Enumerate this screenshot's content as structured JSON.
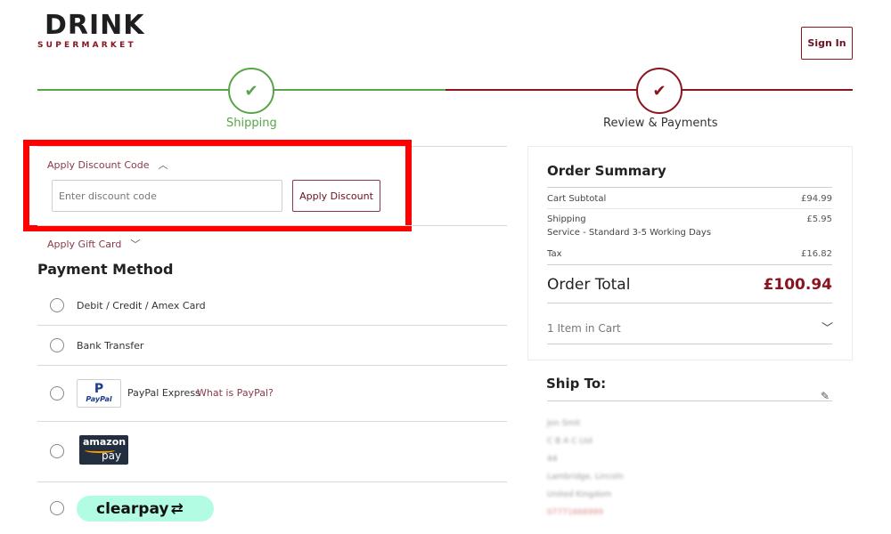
{
  "header": {
    "logo_main": "DRINK",
    "logo_sub": "SUPERMARKET",
    "signin_label": "Sign In"
  },
  "progress": {
    "steps": [
      {
        "label": "Shipping",
        "status": "complete",
        "color": "#58a449"
      },
      {
        "label": "Review & Payments",
        "status": "current",
        "color": "#8a1420"
      }
    ]
  },
  "discount": {
    "toggle_label": "Apply Discount Code",
    "input_value": "",
    "input_placeholder": "Enter discount code",
    "button_label": "Apply Discount",
    "highlight_color": "#ff0000"
  },
  "gift_card": {
    "toggle_label": "Apply Gift Card"
  },
  "payment": {
    "title": "Payment Method",
    "methods": [
      {
        "label": "Debit / Credit / Amex Card"
      },
      {
        "label": "Bank Transfer"
      },
      {
        "label": "PayPal Express",
        "link": "What is PayPal?",
        "logo_line1": "P",
        "logo_line2": "PayPal"
      },
      {
        "logo_line1": "amazon",
        "logo_line2": "pay"
      },
      {
        "logo_text": "clearpay"
      }
    ]
  },
  "summary": {
    "title": "Order Summary",
    "subtotal_label": "Cart Subtotal",
    "subtotal_value": "£94.99",
    "shipping_label": "Shipping",
    "shipping_value": "£5.95",
    "shipping_service": "Service - Standard 3-5 Working Days",
    "tax_label": "Tax",
    "tax_value": "£16.82",
    "total_label": "Order Total",
    "total_value": "£100.94",
    "cart_items": "1 Item in Cart"
  },
  "ship_to": {
    "title": "Ship To:",
    "lines": [
      "Jon Smit",
      "C B A C Ltd",
      "44",
      "Lambridge, Lincoln",
      "United Kingdom",
      "07771666999"
    ]
  },
  "colors": {
    "brand": "#8a1420",
    "success": "#58a449"
  }
}
